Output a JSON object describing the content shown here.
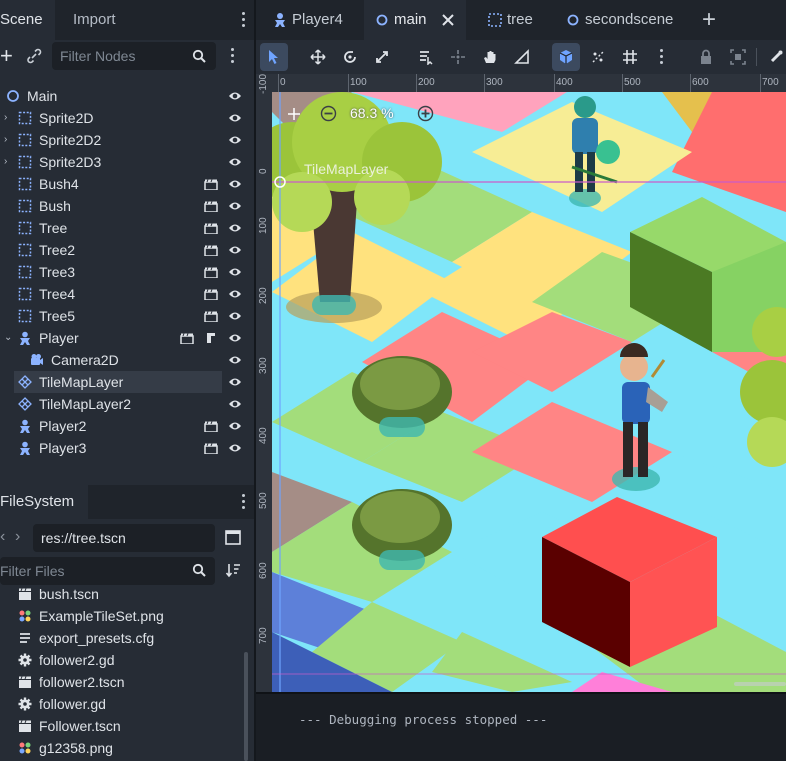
{
  "scene_dock": {
    "tabs": [
      {
        "label": "Scene"
      },
      {
        "label": "Import"
      }
    ],
    "filter_placeholder": "Filter Nodes",
    "nodes": [
      {
        "label": "Main",
        "type": "root"
      },
      {
        "label": "Sprite2D",
        "type": "sprite"
      },
      {
        "label": "Sprite2D2",
        "type": "sprite"
      },
      {
        "label": "Sprite2D3",
        "type": "sprite"
      },
      {
        "label": "Bush4",
        "type": "sprite"
      },
      {
        "label": "Bush",
        "type": "sprite"
      },
      {
        "label": "Tree",
        "type": "sprite"
      },
      {
        "label": "Tree2",
        "type": "sprite"
      },
      {
        "label": "Tree3",
        "type": "sprite"
      },
      {
        "label": "Tree4",
        "type": "sprite"
      },
      {
        "label": "Tree5",
        "type": "sprite"
      },
      {
        "label": "Player",
        "type": "character"
      },
      {
        "label": "Camera2D",
        "type": "camera"
      },
      {
        "label": "TileMapLayer",
        "type": "tilemap"
      },
      {
        "label": "TileMapLayer2",
        "type": "tilemap"
      },
      {
        "label": "Player2",
        "type": "character"
      },
      {
        "label": "Player3",
        "type": "character"
      }
    ]
  },
  "filesystem_dock": {
    "tab": "FileSystem",
    "path": "res://tree.tscn",
    "filter_placeholder": "Filter Files",
    "files": [
      {
        "label": "bush.tscn",
        "icon": "scene-icon"
      },
      {
        "label": "ExampleTileSet.png",
        "icon": "image-icon"
      },
      {
        "label": "export_presets.cfg",
        "icon": "text-file-icon"
      },
      {
        "label": "follower2.gd",
        "icon": "gear-icon"
      },
      {
        "label": "follower2.tscn",
        "icon": "scene-icon"
      },
      {
        "label": "follower.gd",
        "icon": "gear-icon"
      },
      {
        "label": "Follower.tscn",
        "icon": "scene-icon"
      },
      {
        "label": "g12358.png",
        "icon": "image-icon"
      }
    ]
  },
  "editor_tabs": [
    {
      "label": "Player4",
      "icon": "character-icon"
    },
    {
      "label": "main",
      "icon": "node-icon",
      "active": true
    },
    {
      "label": "tree",
      "icon": "sprite-icon"
    },
    {
      "label": "secondscene",
      "icon": "node-icon"
    }
  ],
  "viewport": {
    "zoom_label": "68.3 %",
    "layer_label": "TileMapLayer",
    "ruler_h": [
      "0",
      "100",
      "200",
      "300",
      "400",
      "500",
      "600",
      "700"
    ],
    "ruler_v": [
      "-100",
      "0",
      "100",
      "200",
      "300",
      "400",
      "500",
      "600",
      "700"
    ]
  },
  "console": {
    "text": "--- Debugging process stopped ---"
  },
  "colors": {
    "accent": "#5f9dff",
    "selection": "#353c47",
    "panel": "#262c35"
  }
}
